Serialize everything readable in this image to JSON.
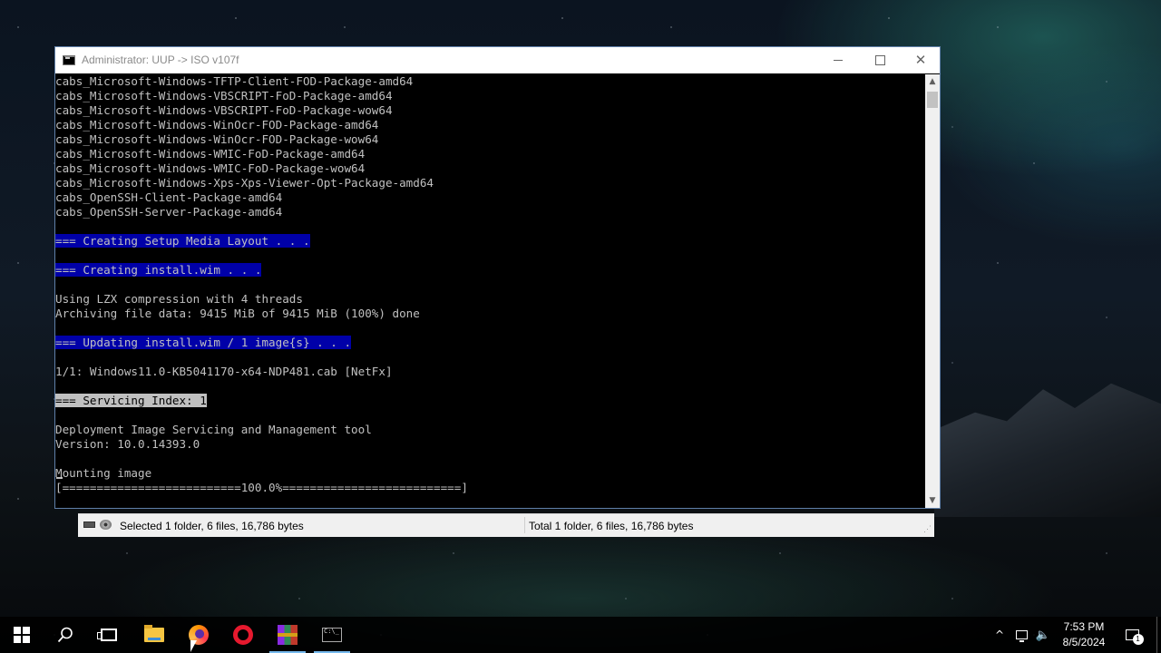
{
  "window": {
    "title": "Administrator:  UUP -> ISO v107f",
    "close_glyph": "✕"
  },
  "console": {
    "lines": [
      {
        "text": "cabs_Microsoft-Windows-TFTP-Client-FOD-Package-amd64",
        "style": ""
      },
      {
        "text": "cabs_Microsoft-Windows-VBSCRIPT-FoD-Package-amd64",
        "style": ""
      },
      {
        "text": "cabs_Microsoft-Windows-VBSCRIPT-FoD-Package-wow64",
        "style": ""
      },
      {
        "text": "cabs_Microsoft-Windows-WinOcr-FOD-Package-amd64",
        "style": ""
      },
      {
        "text": "cabs_Microsoft-Windows-WinOcr-FOD-Package-wow64",
        "style": ""
      },
      {
        "text": "cabs_Microsoft-Windows-WMIC-FoD-Package-amd64",
        "style": ""
      },
      {
        "text": "cabs_Microsoft-Windows-WMIC-FoD-Package-wow64",
        "style": ""
      },
      {
        "text": "cabs_Microsoft-Windows-Xps-Xps-Viewer-Opt-Package-amd64",
        "style": ""
      },
      {
        "text": "cabs_OpenSSH-Client-Package-amd64",
        "style": ""
      },
      {
        "text": "cabs_OpenSSH-Server-Package-amd64",
        "style": ""
      },
      {
        "text": "",
        "style": ""
      },
      {
        "text": "=== Creating Setup Media Layout . . .",
        "style": "hl"
      },
      {
        "text": "",
        "style": ""
      },
      {
        "text": "=== Creating install.wim . . .",
        "style": "hl"
      },
      {
        "text": "",
        "style": ""
      },
      {
        "text": "Using LZX compression with 4 threads",
        "style": ""
      },
      {
        "text": "Archiving file data: 9415 MiB of 9415 MiB (100%) done",
        "style": ""
      },
      {
        "text": "",
        "style": ""
      },
      {
        "text": "=== Updating install.wim / 1 image{s} . . .",
        "style": "hl"
      },
      {
        "text": "",
        "style": ""
      },
      {
        "text": "1/1: Windows11.0-KB5041170-x64-NDP481.cab [NetFx]",
        "style": ""
      },
      {
        "text": "",
        "style": ""
      },
      {
        "text": "=== Servicing Index: 1",
        "style": "sel"
      },
      {
        "text": "",
        "style": ""
      },
      {
        "text": "Deployment Image Servicing and Management tool",
        "style": ""
      },
      {
        "text": "Version: 10.0.14393.0",
        "style": ""
      },
      {
        "text": "",
        "style": ""
      },
      {
        "text": "Mounting image",
        "style": ""
      },
      {
        "text": "[==========================100.0%==========================]",
        "style": ""
      }
    ]
  },
  "statusbar": {
    "left": "Selected 1 folder, 6 files, 16,786 bytes",
    "right": "Total 1 folder, 6 files, 16,786 bytes"
  },
  "tray": {
    "time": "7:53 PM",
    "date": "8/5/2024",
    "notification_count": "1",
    "chevron": "^",
    "volume_glyph": "🔈"
  }
}
